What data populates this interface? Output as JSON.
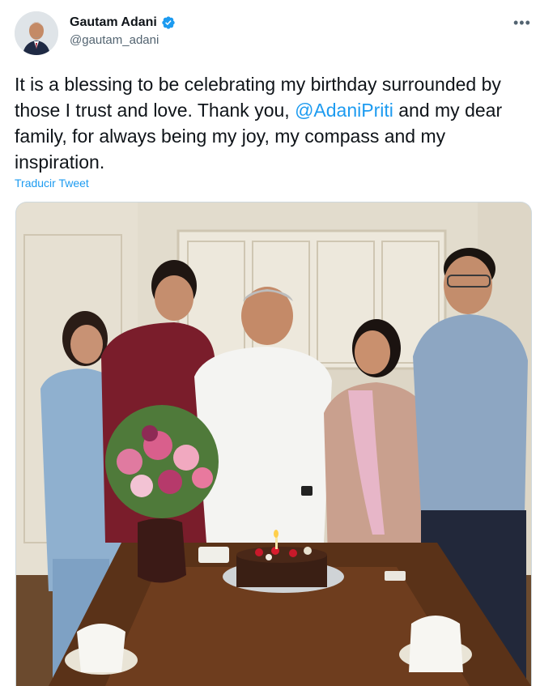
{
  "author": {
    "name": "Gautam Adani",
    "handle": "@gautam_adani",
    "verified_badge_icon": "verified-badge-icon",
    "avatar_icon": "avatar"
  },
  "menu": {
    "more_label": "•••"
  },
  "tweet": {
    "text_before": "It is a blessing to be celebrating my birthday surrounded by those I trust and love. Thank you, ",
    "mention": "@AdaniPriti",
    "text_after": " and my dear family, for always being my joy, my compass and my inspiration.",
    "translate_label": "Traducir Tweet"
  },
  "media": {
    "description_icon": "photo-family-birthday"
  },
  "colors": {
    "accent": "#1d9bf0",
    "text": "#0f1419",
    "muted": "#536471"
  }
}
